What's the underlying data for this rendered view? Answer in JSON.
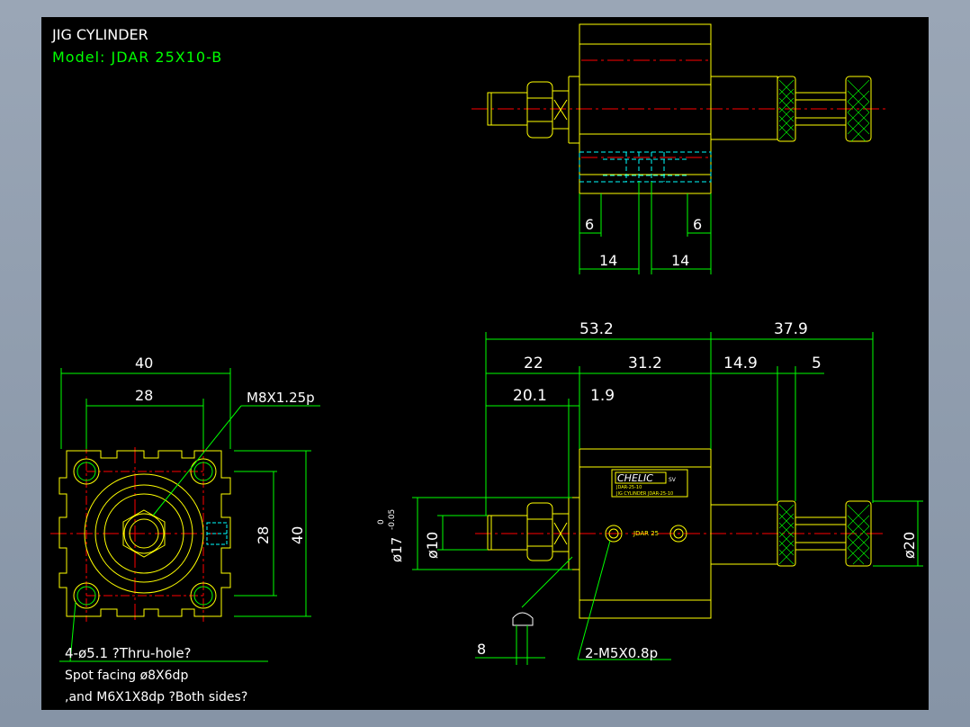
{
  "header": {
    "title": "JIG CYLINDER",
    "model": "Model: JDAR 25X10-B"
  },
  "colors": {
    "background": "#000000",
    "frame": "#8e9aab",
    "outline": "#ffff00",
    "dimension": "#00ff00",
    "centerline": "#ff0000",
    "hidden": "#00ffff",
    "text_white": "#ffffff"
  },
  "dimensions": {
    "front": {
      "width_outer": "40",
      "width_inner": "28",
      "height_inner": "28",
      "height_outer": "40",
      "thread": "M8X1.25p"
    },
    "top": {
      "left_small": "6",
      "right_small": "6",
      "left_big": "14",
      "right_big": "14"
    },
    "side": {
      "total": "53.2",
      "right_total": "37.9",
      "seg_22": "22",
      "seg_31_2": "31.2",
      "seg_14_9": "14.9",
      "seg_5": "5",
      "seg_20_1": "20.1",
      "seg_1_9": "1.9",
      "dia_10": "ø10",
      "dia_20": "ø20",
      "dia_17": "ø17",
      "tol_upper": "0",
      "tol_lower": "-0.05",
      "wrench": "8",
      "port": "2-M5X0.8p"
    }
  },
  "notes": {
    "line1": "4-ø5.1 ?Thru-hole?",
    "line2": "Spot facing  ø8X6dp",
    "line3": ",and M6X1X8dp ?Both sides?"
  },
  "labels": {
    "brand": "CHELIC",
    "brand_suffix": "SV",
    "plate_line1": "JDAR-25-10",
    "plate_line2": "JIG CYLINDER  JDAR-25-10",
    "body_mark": "JDAR 25"
  }
}
